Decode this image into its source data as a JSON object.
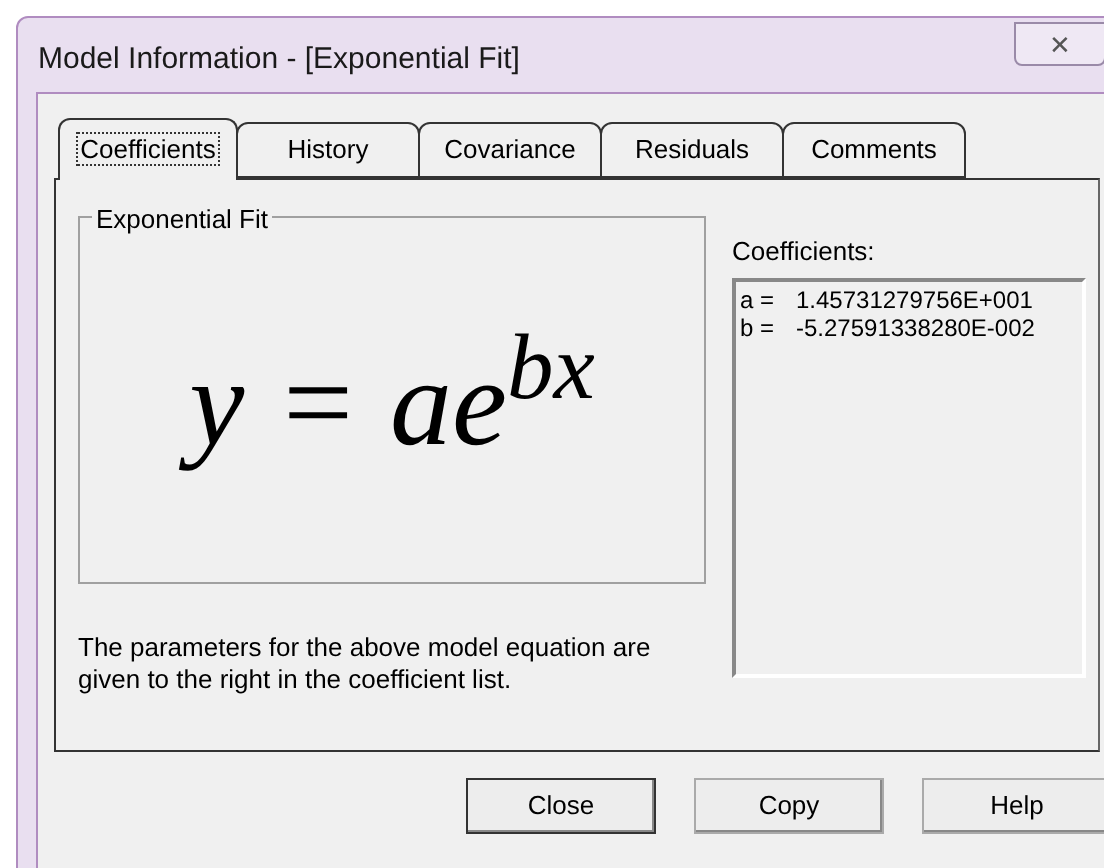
{
  "window": {
    "title": "Model Information - [Exponential Fit]",
    "close": "✕"
  },
  "tabs": [
    {
      "label": "Coefficients",
      "selected": true
    },
    {
      "label": "History",
      "selected": false
    },
    {
      "label": "Covariance",
      "selected": false
    },
    {
      "label": "Residuals",
      "selected": false
    },
    {
      "label": "Comments",
      "selected": false
    }
  ],
  "group": {
    "title": "Exponential Fit",
    "equation": "y = ae$^{bx}$"
  },
  "description": "The parameters for the above model equation are given to the right in the coefficient list.",
  "coefficients": {
    "label": "Coefficients:",
    "rows": [
      {
        "name": "a =",
        "value": "1.45731279756E+001"
      },
      {
        "name": "b =",
        "value": "-5.27591338280E-002"
      }
    ]
  },
  "buttons": [
    "Close",
    "Copy",
    "Help"
  ]
}
